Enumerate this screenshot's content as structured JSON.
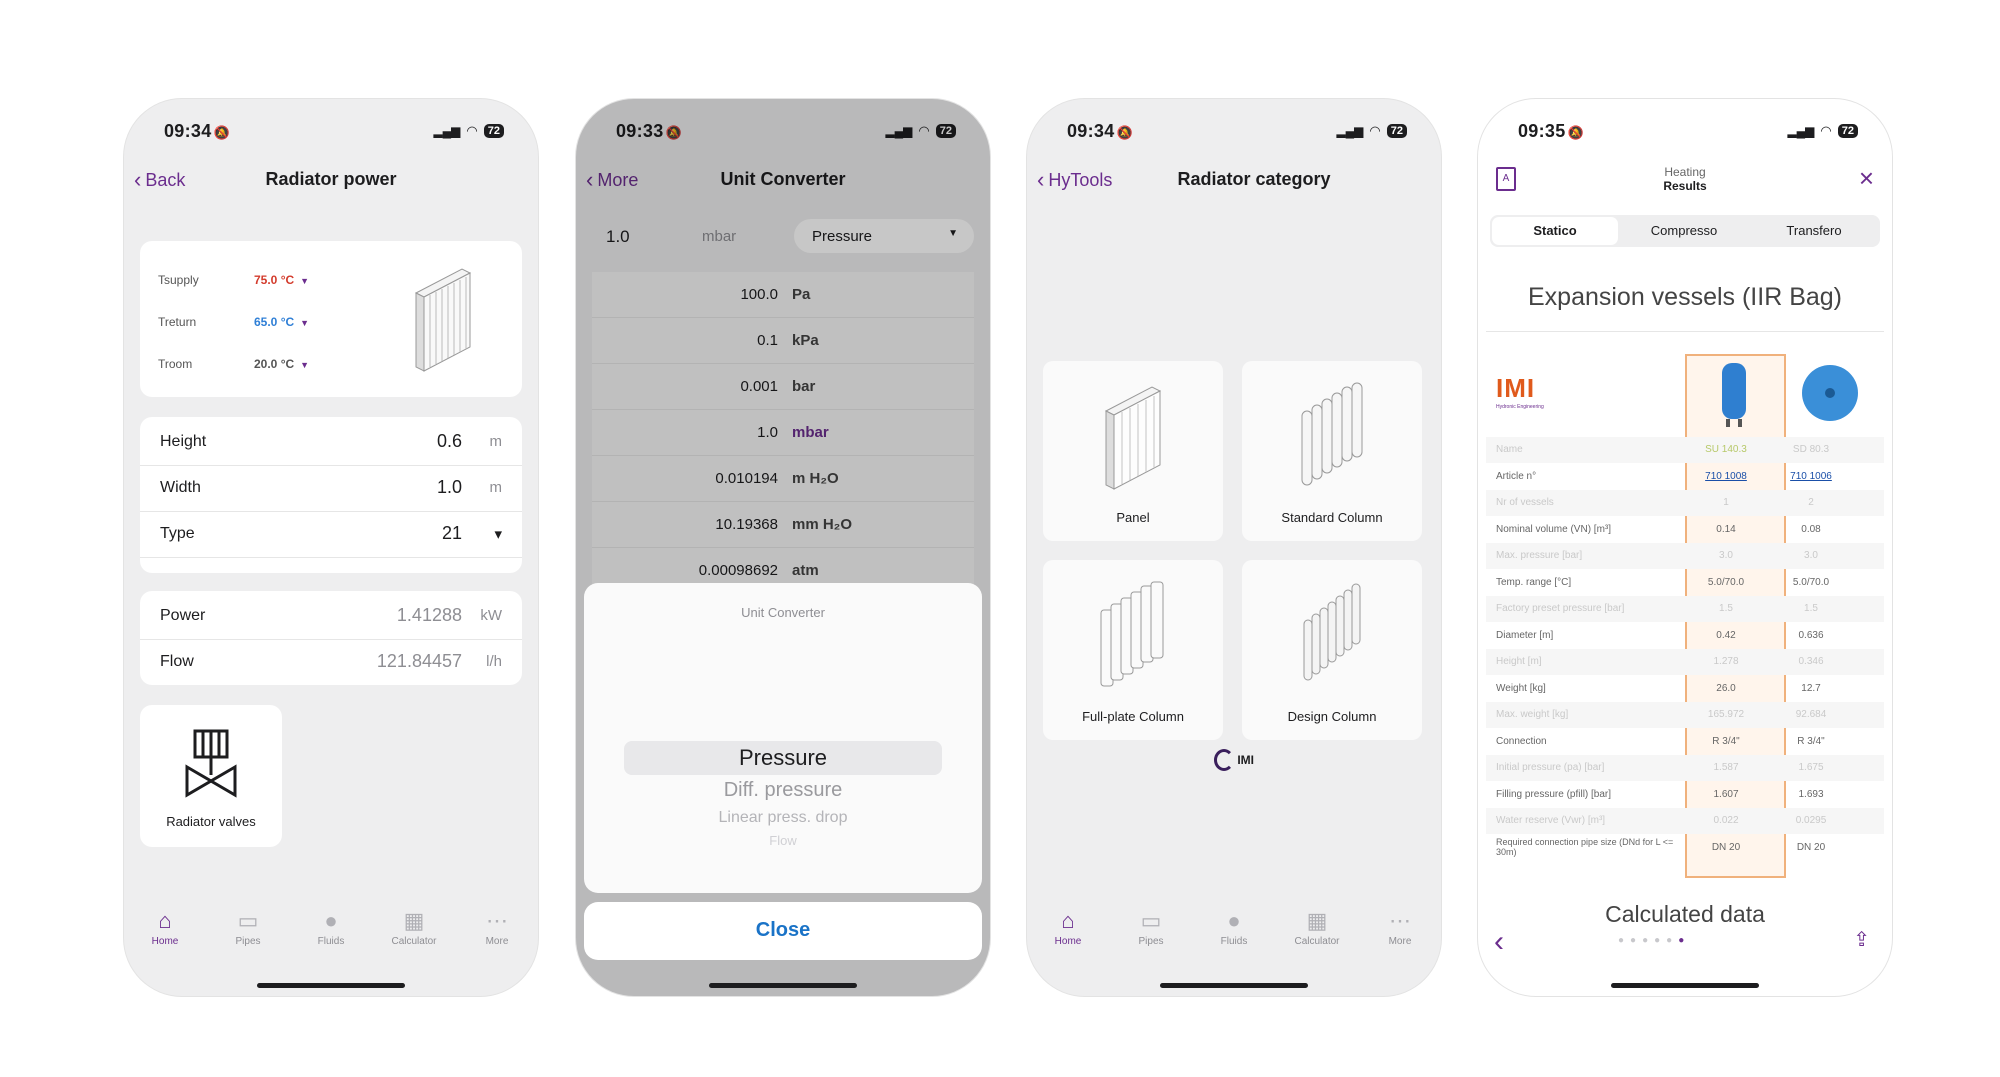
{
  "phone1": {
    "time": "09:34",
    "battery": "72",
    "back_label": "Back",
    "title": "Radiator power",
    "temps": [
      {
        "label": "Tsupply",
        "value": "75.0 °C",
        "color": "#d33b2c"
      },
      {
        "label": "Treturn",
        "value": "65.0 °C",
        "color": "#2f7fd6"
      },
      {
        "label": "Troom",
        "value": "20.0 °C",
        "color": "#1d1d1f"
      }
    ],
    "fields": [
      {
        "label": "Height",
        "value": "0.6",
        "unit": "m"
      },
      {
        "label": "Width",
        "value": "1.0",
        "unit": "m"
      },
      {
        "label": "Type",
        "value": "21",
        "unit": "▾"
      }
    ],
    "results": [
      {
        "label": "Power",
        "value": "1.41288",
        "unit": "kW"
      },
      {
        "label": "Flow",
        "value": "121.84457",
        "unit": "l/h"
      }
    ],
    "valves_label": "Radiator valves",
    "tabs": [
      "Home",
      "Pipes",
      "Fluids",
      "Calculator",
      "More"
    ]
  },
  "phone2": {
    "time": "09:33",
    "battery": "72",
    "back_label": "More",
    "title": "Unit Converter",
    "input_value": "1.0",
    "input_unit": "mbar",
    "quantity": "Pressure",
    "rows": [
      {
        "value": "100.0",
        "unit": "Pa"
      },
      {
        "value": "0.1",
        "unit": "kPa"
      },
      {
        "value": "0.001",
        "unit": "bar"
      },
      {
        "value": "1.0",
        "unit": "mbar"
      },
      {
        "value": "0.010194",
        "unit": "m H₂O"
      },
      {
        "value": "10.19368",
        "unit": "mm H₂O"
      },
      {
        "value": "0.00098692",
        "unit": "atm"
      }
    ],
    "sheet_title": "Unit Converter",
    "picker": [
      "Pressure",
      "Diff. pressure",
      "Linear press. drop",
      "Flow"
    ],
    "close_label": "Close"
  },
  "phone3": {
    "time": "09:34",
    "battery": "72",
    "back_label": "HyTools",
    "title": "Radiator category",
    "categories": [
      "Panel",
      "Standard Column",
      "Full-plate Column",
      "Design Column"
    ],
    "logo": "IMI",
    "tabs": [
      "Home",
      "Pipes",
      "Fluids",
      "Calculator",
      "More"
    ]
  },
  "phone4": {
    "time": "09:35",
    "battery": "72",
    "header_top": "Heating",
    "header_bottom": "Results",
    "segments": [
      "Statico",
      "Compresso",
      "Transfero"
    ],
    "heading": "Expansion vessels (IIR Bag)",
    "brand": "IMI",
    "brand_sub": "Hydronic Engineering",
    "table": [
      {
        "k": "Name",
        "v1": "SU 140.3",
        "v2": "SD 80.3",
        "faded": true
      },
      {
        "k": "Article n°",
        "v1": "710 1008",
        "v2": "710 1006",
        "link": true
      },
      {
        "k": "Nr of vessels",
        "v1": "1",
        "v2": "2",
        "faded": true
      },
      {
        "k": "Nominal volume (VN) [m³]",
        "v1": "0.14",
        "v2": "0.08"
      },
      {
        "k": "Max. pressure [bar]",
        "v1": "3.0",
        "v2": "3.0",
        "faded": true
      },
      {
        "k": "Temp. range [°C]",
        "v1": "5.0/70.0",
        "v2": "5.0/70.0"
      },
      {
        "k": "Factory preset pressure [bar]",
        "v1": "1.5",
        "v2": "1.5",
        "faded": true
      },
      {
        "k": "Diameter [m]",
        "v1": "0.42",
        "v2": "0.636"
      },
      {
        "k": "Height [m]",
        "v1": "1.278",
        "v2": "0.346",
        "faded": true
      },
      {
        "k": "Weight [kg]",
        "v1": "26.0",
        "v2": "12.7"
      },
      {
        "k": "Max. weight [kg]",
        "v1": "165.972",
        "v2": "92.684",
        "faded": true
      },
      {
        "k": "Connection",
        "v1": "R 3/4\"",
        "v2": "R 3/4\""
      },
      {
        "k": "Initial pressure (pa) [bar]",
        "v1": "1.587",
        "v2": "1.675",
        "faded": true
      },
      {
        "k": "Filling pressure (pfill) [bar]",
        "v1": "1.607",
        "v2": "1.693"
      },
      {
        "k": "Water reserve (Vwr) [m³]",
        "v1": "0.022",
        "v2": "0.0295",
        "faded": true
      },
      {
        "k": "Required connection pipe size (DNd for L <= 30m)",
        "v1": "DN 20",
        "v2": "DN 20"
      }
    ],
    "footer_heading": "Calculated data"
  }
}
